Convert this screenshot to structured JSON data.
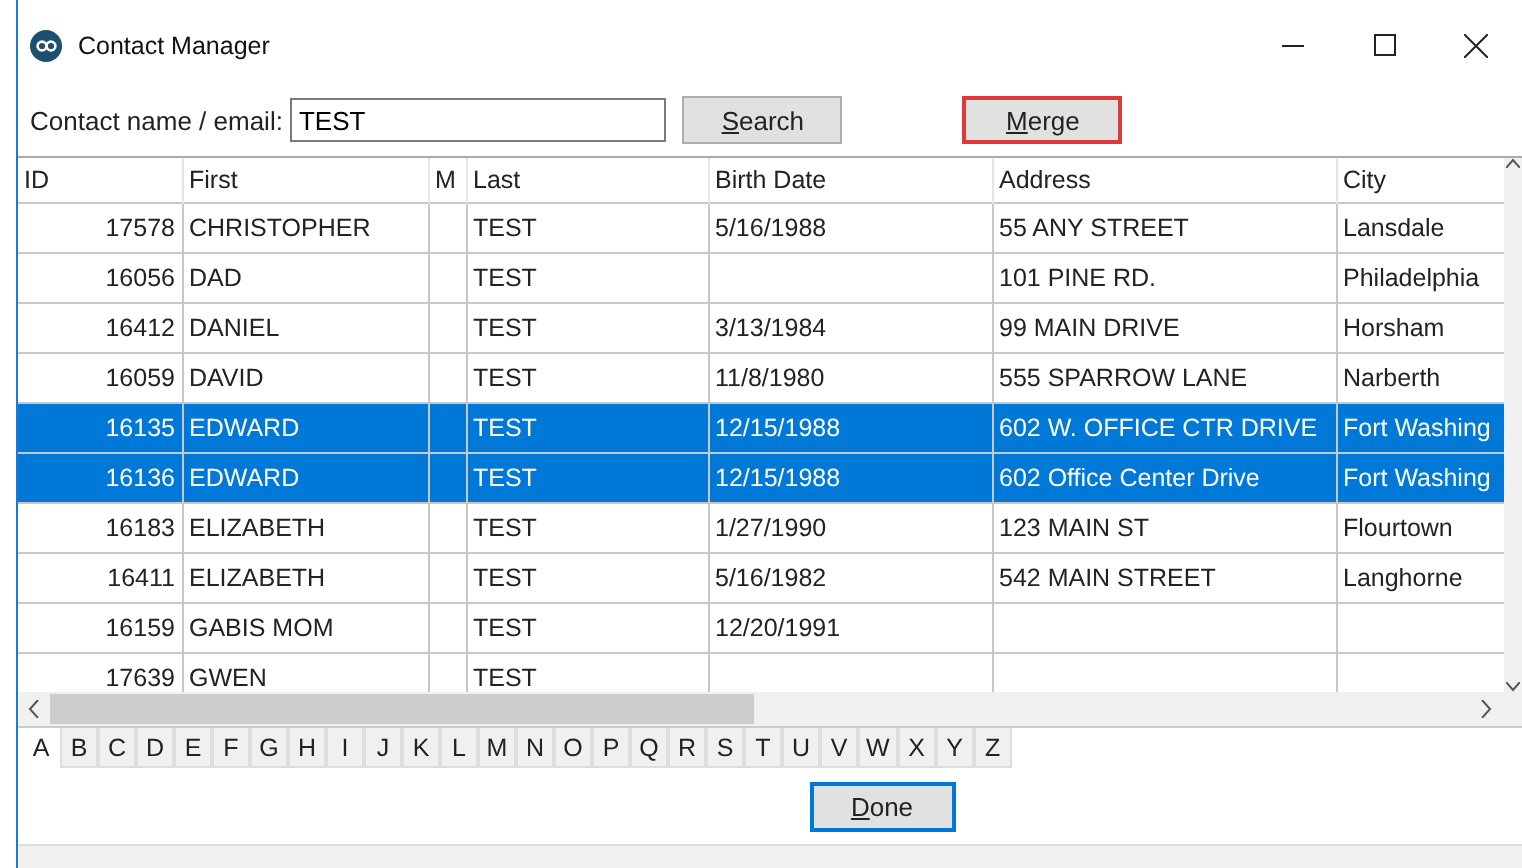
{
  "window": {
    "title": "Contact Manager"
  },
  "search": {
    "label": "Contact name / email:",
    "value": "TEST"
  },
  "buttons": [
    {
      "label": "Search",
      "highlighted": false
    },
    {
      "label": "Merge",
      "highlighted": true
    }
  ],
  "table": {
    "columns": [
      "ID",
      "First",
      "M",
      "Last",
      "Birth Date",
      "Address",
      "City"
    ],
    "rows": [
      {
        "cells": [
          "17578",
          "CHRISTOPHER",
          "",
          "TEST",
          "5/16/1988",
          "55 ANY STREET",
          "Lansdale"
        ],
        "selected": false
      },
      {
        "cells": [
          "16056",
          "DAD",
          "",
          "TEST",
          "",
          "101 PINE RD.",
          "Philadelphia"
        ],
        "selected": false
      },
      {
        "cells": [
          "16412",
          "DANIEL",
          "",
          "TEST",
          "3/13/1984",
          "99 MAIN DRIVE",
          "Horsham"
        ],
        "selected": false
      },
      {
        "cells": [
          "16059",
          "DAVID",
          "",
          "TEST",
          "11/8/1980",
          "555 SPARROW LANE",
          "Narberth"
        ],
        "selected": false
      },
      {
        "cells": [
          "16135",
          "EDWARD",
          "",
          "TEST",
          "12/15/1988",
          "602 W. OFFICE CTR DRIVE",
          "Fort Washing"
        ],
        "selected": true
      },
      {
        "cells": [
          "16136",
          "EDWARD",
          "",
          "TEST",
          "12/15/1988",
          "602 Office Center Drive",
          "Fort Washing"
        ],
        "selected": true
      },
      {
        "cells": [
          "16183",
          "ELIZABETH",
          "",
          "TEST",
          "1/27/1990",
          "123 MAIN ST",
          "Flourtown"
        ],
        "selected": false
      },
      {
        "cells": [
          "16411",
          "ELIZABETH",
          "",
          "TEST",
          "5/16/1982",
          "542 MAIN STREET",
          "Langhorne"
        ],
        "selected": false
      },
      {
        "cells": [
          "16159",
          "GABIS MOM",
          "",
          "TEST",
          "12/20/1991",
          "",
          ""
        ],
        "selected": false
      },
      {
        "cells": [
          "17639",
          "GWEN",
          "",
          "TEST",
          "",
          "",
          ""
        ],
        "selected": false
      }
    ]
  },
  "letter_tabs": [
    {
      "label": "A",
      "selected": true
    },
    {
      "label": "B",
      "selected": false
    },
    {
      "label": "C",
      "selected": false
    },
    {
      "label": "D",
      "selected": false
    },
    {
      "label": "E",
      "selected": false
    },
    {
      "label": "F",
      "selected": false
    },
    {
      "label": "G",
      "selected": false
    },
    {
      "label": "H",
      "selected": false
    },
    {
      "label": "I",
      "selected": false
    },
    {
      "label": "J",
      "selected": false
    },
    {
      "label": "K",
      "selected": false
    },
    {
      "label": "L",
      "selected": false
    },
    {
      "label": "M",
      "selected": false
    },
    {
      "label": "N",
      "selected": false
    },
    {
      "label": "O",
      "selected": false
    },
    {
      "label": "P",
      "selected": false
    },
    {
      "label": "Q",
      "selected": false
    },
    {
      "label": "R",
      "selected": false
    },
    {
      "label": "S",
      "selected": false
    },
    {
      "label": "T",
      "selected": false
    },
    {
      "label": "U",
      "selected": false
    },
    {
      "label": "V",
      "selected": false
    },
    {
      "label": "W",
      "selected": false
    },
    {
      "label": "X",
      "selected": false
    },
    {
      "label": "Y",
      "selected": false
    },
    {
      "label": "Z",
      "selected": false
    }
  ],
  "done_button": {
    "label": "Done"
  }
}
